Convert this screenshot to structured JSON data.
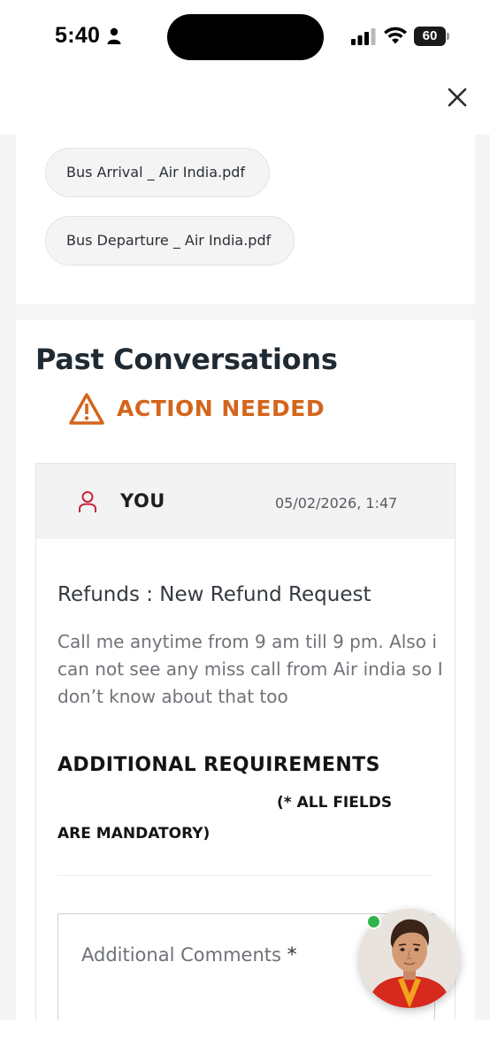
{
  "status_bar": {
    "time": "5:40",
    "battery": "60"
  },
  "header": {
    "close_icon": "close-icon"
  },
  "attachments": [
    {
      "label": "Bus Arrival _ Air India.pdf"
    },
    {
      "label": "Bus Departure _ Air India.pdf"
    }
  ],
  "conversations": {
    "title": "Past Conversations",
    "action_label": "ACTION NEEDED",
    "action_color": "#d4651c",
    "message": {
      "sender": "YOU",
      "timestamp": "05/02/2026, 1:47",
      "subject": "Refunds : New Refund Request",
      "body": "Call me anytime from 9 am till 9 pm. Also i can not see any miss call from Air india so I don’t know about that too"
    },
    "requirements": {
      "title": "ADDITIONAL REQUIREMENTS",
      "note_part1": "(* ALL FIELDS",
      "note_part2": "ARE MANDATORY)"
    },
    "comments_field": {
      "label": "Additional Comments",
      "required_mark": "*"
    }
  },
  "assistant": {
    "status_color": "#2fb34a"
  }
}
